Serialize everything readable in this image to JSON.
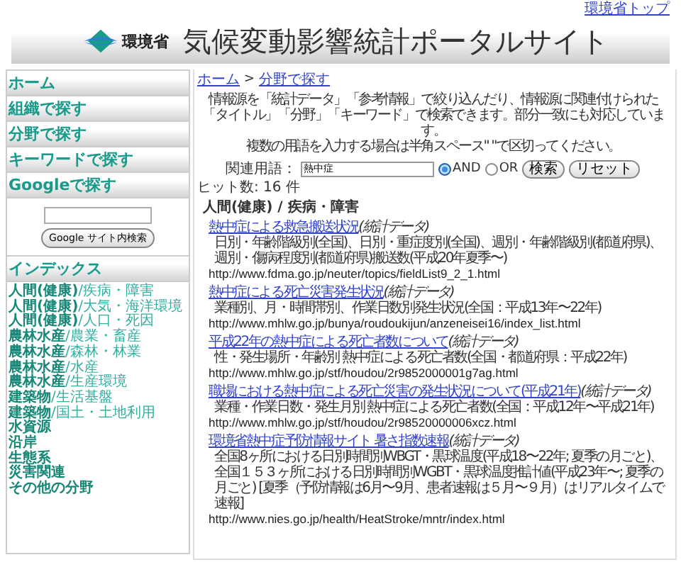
{
  "top_link": "環境省トップ",
  "header": {
    "org": "環境省",
    "title": "気候変動影響統計ポータルサイト"
  },
  "sidebar": {
    "menu": [
      {
        "label": "ホーム"
      },
      {
        "label": "組織で探す"
      },
      {
        "label": "分野で探す"
      },
      {
        "label": "キーワードで探す"
      },
      {
        "label": "Googleで探す"
      }
    ],
    "google_button": "Google サイト内検索",
    "index_title": "インデックス",
    "index_items": [
      {
        "main": "人間(健康)",
        "sub": "/疾病・障害"
      },
      {
        "main": "人間(健康)",
        "sub": "/大気・海洋環境"
      },
      {
        "main": "人間(健康)",
        "sub": "/人口・死因"
      },
      {
        "main": "農林水産",
        "sub": "/農業・畜産"
      },
      {
        "main": "農林水産",
        "sub": "/森林・林業"
      },
      {
        "main": "農林水産",
        "sub": "/水産"
      },
      {
        "main": "農林水産",
        "sub": "/生産環境"
      },
      {
        "main": "建築物",
        "sub": "/生活基盤"
      },
      {
        "main": "建築物",
        "sub": "/国土・土地利用"
      },
      {
        "main": "水資源"
      },
      {
        "main": "沿岸"
      },
      {
        "main": "生態系"
      },
      {
        "main": "災害関連"
      },
      {
        "main": "その他の分野"
      }
    ]
  },
  "breadcrumb": {
    "links": [
      "ホーム",
      "分野で探す"
    ],
    "separator": ">"
  },
  "intro": [
    "情報源を「統計データ」「参考情報」で絞り込んだり、情報源に関連付けられた",
    "「タイトル」「分野」「キーワード」で検索できます。部分一致にも対応しています。",
    "複数の用語を入力する場合は半角スペース\" \"で区切ってください。"
  ],
  "search": {
    "label": "関連用語：",
    "value": "熱中症",
    "options": [
      {
        "label": "AND",
        "selected": true
      },
      {
        "label": "OR",
        "selected": false
      }
    ],
    "buttons": [
      "検索",
      "リセット"
    ]
  },
  "hits": "ヒット数: 16 件",
  "category": "人間(健康) / 疾病・障害",
  "results": [
    {
      "title": "熱中症による救急搬送状況",
      "tag": "(統計データ)",
      "description": "日別・年齢階級別(全国)、日別・重症度別(全国)、週別・年齢階級別(都道府県)、週別・傷病程度別(都道府県)搬送数(平成20年夏季〜)",
      "url": "http://www.fdma.go.jp/neuter/topics/fieldList9_2_1.html"
    },
    {
      "title": "熱中症による死亡災害発生状況",
      "tag": "(統計データ)",
      "description": "業種別、月・時間帯別、作業日数別発生状況(全国：平成13年〜22年)",
      "url": "http://www.mhlw.go.jp/bunya/roudoukijun/anzeneisei16/index_list.html"
    },
    {
      "title": "平成22年の熱中症による死亡者数について",
      "tag": "(統計データ)",
      "description": "性・発生場所・年齢別 熱中症による死亡者数(全国・都道府県：平成22年)",
      "url": "http://www.mhlw.go.jp/stf/houdou/2r9852000001g7ag.html"
    },
    {
      "title": "職場における熱中症による死亡災害の発生状況について(平成21年)",
      "tag": "(統計データ)",
      "description": "業種・作業日数・発生月別 熱中症による死亡者数(全国：平成12年〜平成21年)",
      "url": "http://www.mhlw.go.jp/stf/houdou/2r98520000006xcz.html"
    },
    {
      "title": "環境省熱中症予防情報サイト 暑さ指数速報",
      "tag": "(統計データ)",
      "description": "全国8ヶ所における日別時間別WBGT・黒球温度(平成18〜22年; 夏季の月ごと)、全国１５３ヶ所における日別時間別WGBT・黒球温度推計値(平成23年〜; 夏季の月ごと) [夏季（予防情報は6月〜9月、患者速報は５月〜９月）はリアルタイムで速報]",
      "url": "http://www.nies.go.jp/health/HeatStroke/mntr/index.html"
    }
  ]
}
